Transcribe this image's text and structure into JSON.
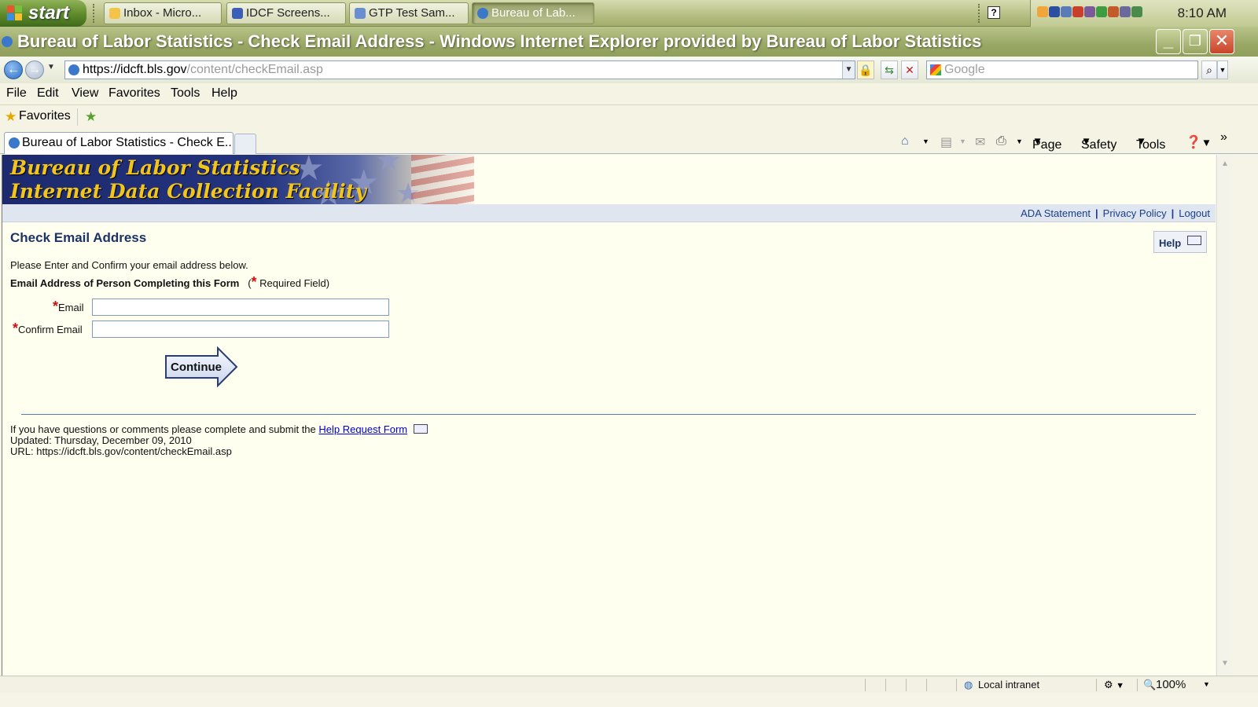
{
  "taskbar": {
    "start_label": "start",
    "tasks": [
      {
        "label": "Inbox - Micro..."
      },
      {
        "label": "IDCF Screens..."
      },
      {
        "label": "GTP Test Sam..."
      },
      {
        "label": "Bureau of Lab..."
      }
    ],
    "clock": "8:10 AM"
  },
  "window": {
    "title": "Bureau of Labor Statistics - Check Email Address - Windows Internet Explorer provided by Bureau of Labor Statistics"
  },
  "address": {
    "url_host": "https://idcft.bls.gov",
    "url_path": "/content/checkEmail.asp",
    "search_placeholder": "Google"
  },
  "menu": [
    "File",
    "Edit",
    "View",
    "Favorites",
    "Tools",
    "Help"
  ],
  "favorites_label": "Favorites",
  "tab_label": "Bureau of Labor Statistics - Check E...",
  "commands": {
    "page": "Page",
    "safety": "Safety",
    "tools": "Tools"
  },
  "banner": {
    "line1": "Bureau of Labor Statistics",
    "line2": "Internet Data Collection Facility"
  },
  "toplinks": {
    "ada": "ADA Statement",
    "privacy": "Privacy Policy",
    "logout": "Logout"
  },
  "page": {
    "title": "Check Email Address",
    "help_label": "Help",
    "intro": "Please Enter and Confirm your email address below.",
    "form_header": "Email Address of Person Completing this Form",
    "required_note_open": "(",
    "required_note": "Required Field)",
    "email_label": "Email",
    "confirm_label": "Confirm Email",
    "email_value": "",
    "confirm_value": "",
    "continue_label": "Continue"
  },
  "footer": {
    "question_text": "If you have questions or comments please complete and submit the",
    "help_link": "Help Request Form",
    "updated": "Updated: Thursday, December 09, 2010",
    "url": "URL: https://idcft.bls.gov/content/checkEmail.asp"
  },
  "status": {
    "zone": "Local intranet",
    "zoom": "100%"
  },
  "colors": {
    "banner_text": "#f2c51c",
    "link": "#1a3e8a",
    "required": "#d01010"
  }
}
